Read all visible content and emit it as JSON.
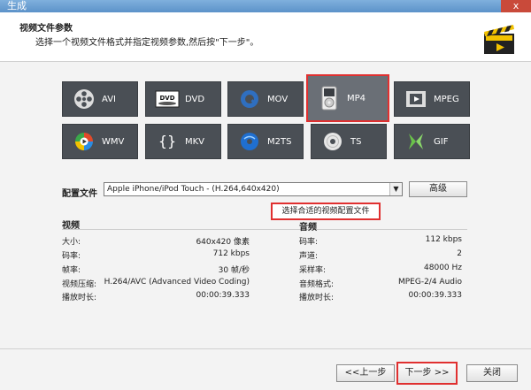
{
  "window": {
    "title": "生成",
    "close_symbol": "x"
  },
  "header": {
    "title": "视频文件参数",
    "subtitle": "选择一个视频文件格式并指定视频参数,然后按\"下一步\"。"
  },
  "formats": [
    {
      "label": "AVI",
      "icon": "film-reel-icon"
    },
    {
      "label": "DVD",
      "icon": "dvd-icon"
    },
    {
      "label": "MOV",
      "icon": "quicktime-icon"
    },
    {
      "label": "MP4",
      "icon": "ipod-icon",
      "selected": true
    },
    {
      "label": "MPEG",
      "icon": "film-strip-icon"
    },
    {
      "label": "WMV",
      "icon": "windows-media-icon"
    },
    {
      "label": "MKV",
      "icon": "braces-icon"
    },
    {
      "label": "M2TS",
      "icon": "bluray-icon"
    },
    {
      "label": "TS",
      "icon": "disc-icon"
    },
    {
      "label": "GIF",
      "icon": "gif-icon"
    }
  ],
  "profile": {
    "label": "配置文件",
    "value": "Apple iPhone/iPod Touch - (H.264,640x420)",
    "advanced_label": "高级",
    "tooltip": "选择合适的视频配置文件"
  },
  "video": {
    "title": "视频",
    "rows": [
      {
        "key": "大小:",
        "value": "640x420 像素"
      },
      {
        "key": "码率:",
        "value": "712 kbps"
      },
      {
        "key": "帧率:",
        "value": "30 帧/秒"
      },
      {
        "key": "视频压缩:",
        "value": "H.264/AVC (Advanced Video Coding)"
      },
      {
        "key": "播放时长:",
        "value": "00:00:39.333"
      }
    ]
  },
  "audio": {
    "title": "音频",
    "rows": [
      {
        "key": "码率:",
        "value": "112 kbps"
      },
      {
        "key": "声道:",
        "value": "2"
      },
      {
        "key": "采样率:",
        "value": "48000 Hz"
      },
      {
        "key": "音频格式:",
        "value": "MPEG-2/4 Audio"
      },
      {
        "key": "播放时长:",
        "value": "00:00:39.333"
      }
    ]
  },
  "footer": {
    "back": "<<上一步",
    "next": "下一步 >>",
    "close": "关闭"
  },
  "colors": {
    "highlight": "#e03030",
    "tile": "#4a4f55"
  }
}
